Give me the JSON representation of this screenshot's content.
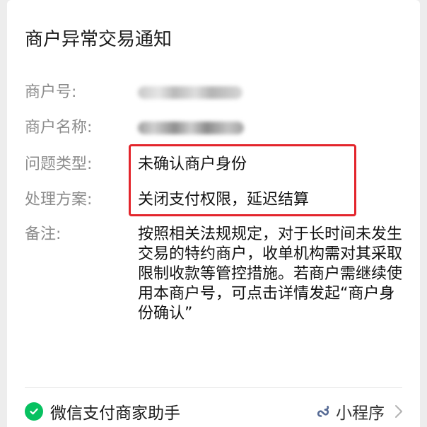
{
  "card": {
    "title": "商户异常交易通知"
  },
  "fields": {
    "merchant_no_label": "商户号:",
    "merchant_name_label": "商户名称:",
    "issue_type_label": "问题类型:",
    "issue_type_value": "未确认商户身份",
    "solution_label": "处理方案:",
    "solution_value": "关闭支付权限，延迟结算",
    "remark_label": "备注:",
    "remark_value": "按照相关法规规定，对于长时间未发生交易的特约商户，收单机构需对其采取限制收款等管控措施。若商户需继续使用本商户号，可点击详情发起“商户身份确认”"
  },
  "footer": {
    "source_name": "微信支付商家助手",
    "mini_program_label": "小程序",
    "source_icon": "wechat-pay-icon",
    "mini_program_icon": "mini-program-icon",
    "chevron_icon": "chevron-right-icon"
  },
  "colors": {
    "highlight_border": "#e3252c",
    "brand_green": "#07c160",
    "mini_program_blue": "#576b95"
  }
}
